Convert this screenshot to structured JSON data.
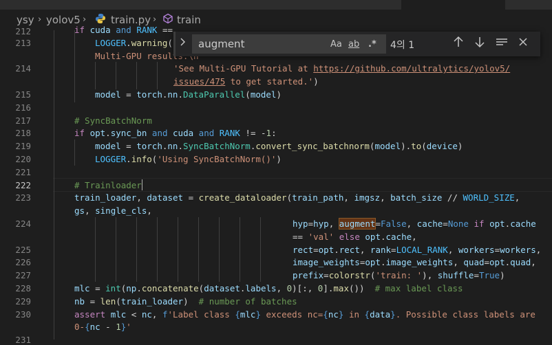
{
  "breadcrumb": {
    "items": [
      "ysy",
      "yolov5",
      "train.py",
      "train"
    ],
    "separator": "›"
  },
  "find_widget": {
    "query": "augment",
    "match_case_label": "Aa",
    "whole_word_label": "ab",
    "regex_label": ".*",
    "result_count": "4의 1"
  },
  "editor": {
    "line_numbers": [
      "212",
      "213",
      "214",
      "215",
      "216",
      "217",
      "218",
      "219",
      "220",
      "221",
      "222",
      "223",
      "224",
      "225",
      "226",
      "227",
      "228",
      "229",
      "230",
      "231"
    ],
    "current_line": "222"
  }
}
